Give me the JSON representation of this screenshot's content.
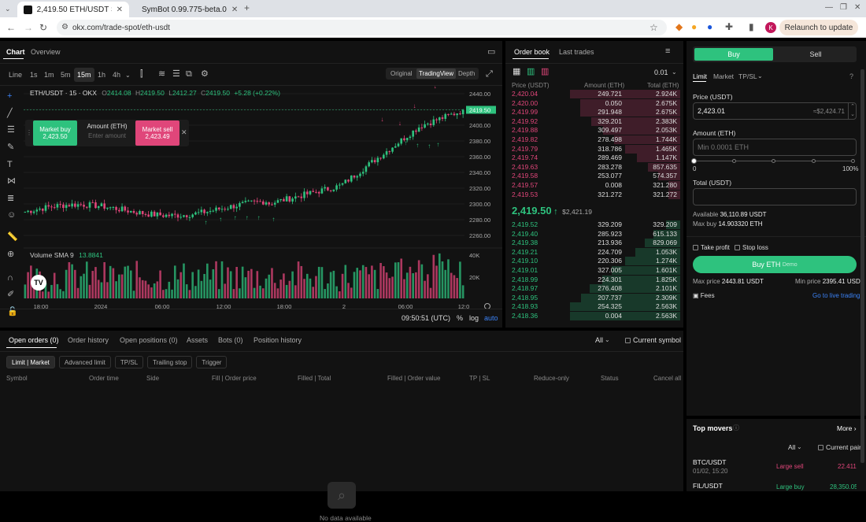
{
  "browser": {
    "tabs": [
      {
        "title": "2,419.50 ETH/USDT Spot",
        "active": true
      },
      {
        "title": "SymBot 0.99.775-beta.0",
        "active": false
      }
    ],
    "url": "okx.com/trade-spot/eth-usdt",
    "relaunch_label": "Relaunch to update",
    "profile_initial": "K"
  },
  "chart": {
    "tabs": [
      "Chart",
      "Overview"
    ],
    "intervals": [
      "Line",
      "1s",
      "1m",
      "5m",
      "15m",
      "1h",
      "4h"
    ],
    "selected_interval": "15m",
    "view_modes": [
      "Original",
      "TradingView",
      "Depth"
    ],
    "selected_view": "TradingView",
    "legend": {
      "symbol": "ETH/USDT · 15 · OKX",
      "o": "2414.08",
      "h": "2419.50",
      "l": "2412.27",
      "c": "2419.50",
      "chg": "+5.28 (+0.22%)"
    },
    "quick_trade": {
      "buy_label": "Market buy",
      "buy_price": "2,423.50",
      "amount_label": "Amount (ETH)",
      "amount_placeholder": "Enter amount",
      "sell_label": "Market sell",
      "sell_price": "2,423.49"
    },
    "price_ticks": [
      "2440.00",
      "2419.50",
      "2400.00",
      "2380.00",
      "2360.00",
      "2340.00",
      "2320.00",
      "2300.00",
      "2280.00",
      "2260.00"
    ],
    "volume_label": "Volume SMA 9",
    "volume_value": "13.8841",
    "volume_ticks": [
      "40K",
      "20K"
    ],
    "time_ticks": [
      "18:00",
      "2024",
      "06:00",
      "12:00",
      "18:00",
      "2",
      "06:00",
      "12:0"
    ],
    "clock": "09:50:51 (UTC)",
    "opts": [
      "%",
      "log",
      "auto"
    ],
    "colors": {
      "up": "#2ec27e",
      "down": "#e0467a"
    }
  },
  "orderbook": {
    "tabs": [
      "Order book",
      "Last trades"
    ],
    "precision": "0.01",
    "headers": [
      "Price (USDT)",
      "Amount (ETH)",
      "Total (ETH)"
    ],
    "asks": [
      [
        "2,420.04",
        "249.721",
        "2.924K"
      ],
      [
        "2,420.00",
        "0.050",
        "2.675K"
      ],
      [
        "2,419.99",
        "291.948",
        "2.675K"
      ],
      [
        "2,419.92",
        "329.201",
        "2.383K"
      ],
      [
        "2,419.88",
        "309.497",
        "2.053K"
      ],
      [
        "2,419.82",
        "278.498",
        "1.744K"
      ],
      [
        "2,419.79",
        "318.786",
        "1.465K"
      ],
      [
        "2,419.74",
        "289.469",
        "1.147K"
      ],
      [
        "2,419.63",
        "283.278",
        "857.635"
      ],
      [
        "2,419.58",
        "253.077",
        "574.357"
      ],
      [
        "2,419.57",
        "0.008",
        "321.280"
      ],
      [
        "2,419.53",
        "321.272",
        "321.272"
      ]
    ],
    "ask_fill": [
      1.0,
      0.91,
      0.91,
      0.81,
      0.7,
      0.6,
      0.5,
      0.39,
      0.29,
      0.2,
      0.11,
      0.11
    ],
    "last_price": "2,419.50",
    "last_arrow": "↑",
    "index_price": "$2,421.19",
    "bids": [
      [
        "2,419.52",
        "329.209",
        "329.209"
      ],
      [
        "2,419.40",
        "285.923",
        "615.133"
      ],
      [
        "2,419.38",
        "213.936",
        "829.069"
      ],
      [
        "2,419.21",
        "224.709",
        "1.053K"
      ],
      [
        "2,419.10",
        "220.306",
        "1.274K"
      ],
      [
        "2,419.01",
        "327.005",
        "1.601K"
      ],
      [
        "2,418.99",
        "224.301",
        "1.825K"
      ],
      [
        "2,418.97",
        "276.408",
        "2.101K"
      ],
      [
        "2,418.95",
        "207.737",
        "2.309K"
      ],
      [
        "2,418.93",
        "254.325",
        "2.563K"
      ],
      [
        "2,418.36",
        "0.004",
        "2.563K"
      ]
    ],
    "bid_fill": [
      0.13,
      0.24,
      0.32,
      0.41,
      0.5,
      0.62,
      0.71,
      0.82,
      0.9,
      1.0,
      1.0
    ]
  },
  "orders": {
    "tabs": [
      "Open orders (0)",
      "Order history",
      "Open positions (0)",
      "Assets",
      "Bots (0)",
      "Position history"
    ],
    "filter_all": "All",
    "current_symbol": "Current symbol",
    "subtabs": [
      "Limit | Market",
      "Advanced limit",
      "TP/SL",
      "Trailing stop",
      "Trigger"
    ],
    "columns": [
      "Symbol",
      "Order time",
      "Side",
      "Fill | Order price",
      "Filled | Total",
      "Filled | Order value",
      "TP | SL",
      "Reduce-only",
      "Status",
      "Cancel all"
    ],
    "empty": "No data available"
  },
  "trade": {
    "buy": "Buy",
    "sell": "Sell",
    "types": [
      "Limit",
      "Market",
      "TP/SL"
    ],
    "price_label": "Price (USDT)",
    "price_value": "2,423.01",
    "price_hint": "≈$2,424.71",
    "amount_label": "Amount (ETH)",
    "amount_placeholder": "Min 0.0001 ETH",
    "slider_min": "0",
    "slider_max": "100%",
    "total_label": "Total (USDT)",
    "available_label": "Available",
    "available_value": "36,110.89 USDT",
    "maxbuy_label": "Max buy",
    "maxbuy_value": "14.903320 ETH",
    "take_profit": "Take profit",
    "stop_loss": "Stop loss",
    "submit": "Buy ETH",
    "submit_tag": "Demo",
    "max_price_label": "Max price",
    "max_price": "2443.81 USDT",
    "min_price_label": "Min price",
    "min_price": "2395.41 USDT",
    "fees": "Fees",
    "live": "Go to live trading"
  },
  "movers": {
    "title": "Top movers",
    "more": "More",
    "filter": "All",
    "current_pair": "Current pair",
    "rows": [
      {
        "pair": "BTC/USDT",
        "time": "01/02, 15:20",
        "type": "Large sell",
        "value": "22.411"
      },
      {
        "pair": "FIL/USDT",
        "time": "",
        "type": "Large buy",
        "value": "28,350.05"
      }
    ]
  }
}
